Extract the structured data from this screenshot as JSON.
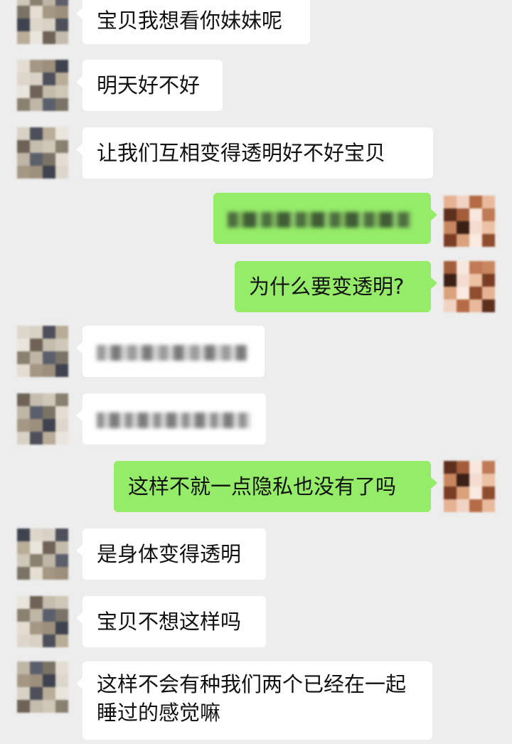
{
  "colors": {
    "background": "#ededed",
    "incoming_bubble": "#ffffff",
    "outgoing_bubble": "#95ec69"
  },
  "messages": [
    {
      "side": "in",
      "text": "宝贝我想看你妹妹呢"
    },
    {
      "side": "in",
      "text": "明天好不好"
    },
    {
      "side": "in",
      "text": "让我们互相变得透明好不好宝贝"
    },
    {
      "side": "out",
      "text": "",
      "redacted": true
    },
    {
      "side": "out",
      "text": "为什么要变透明?"
    },
    {
      "side": "in",
      "text": "",
      "redacted": true
    },
    {
      "side": "in",
      "text": "",
      "redacted": true
    },
    {
      "side": "out",
      "text": "这样不就一点隐私也没有了吗"
    },
    {
      "side": "in",
      "text": "是身体变得透明"
    },
    {
      "side": "in",
      "text": "宝贝不想这样吗"
    },
    {
      "side": "in",
      "text": "这样不会有种我们两个已经在一起睡过的感觉嘛"
    }
  ]
}
